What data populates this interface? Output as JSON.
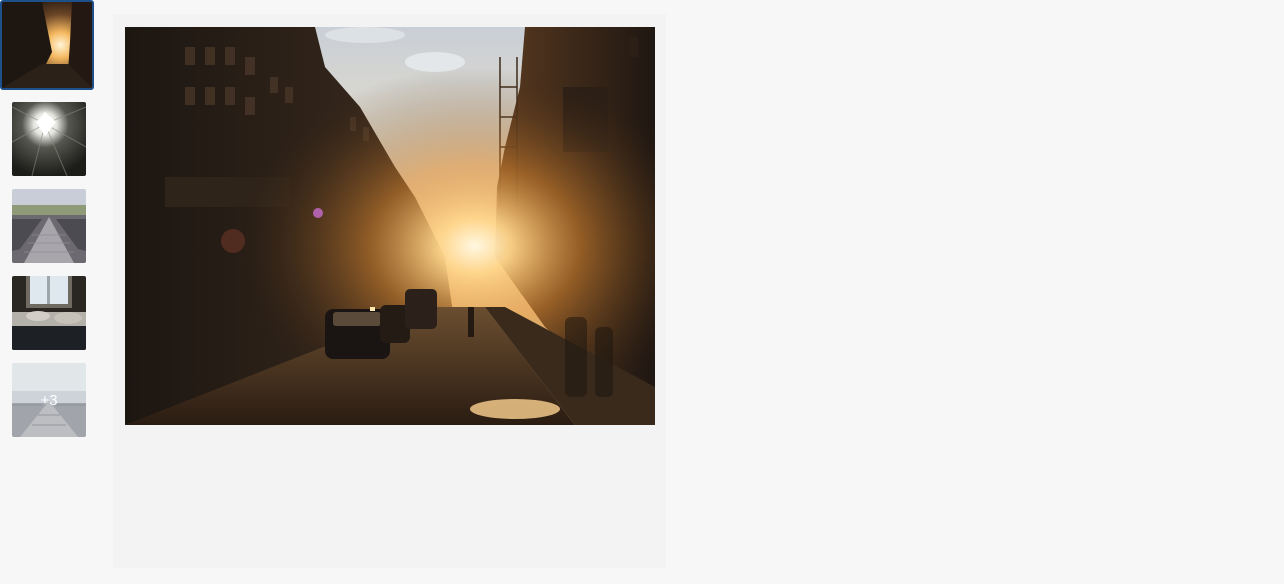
{
  "gallery": {
    "selected_index": 0,
    "thumbnails": [
      {
        "id": "street-sunset",
        "icon": "street-sunset-thumbnail"
      },
      {
        "id": "tunnel-light",
        "icon": "tunnel-light-thumbnail"
      },
      {
        "id": "bridge-walkway",
        "icon": "bridge-walkway-thumbnail"
      },
      {
        "id": "bedroom-window",
        "icon": "bedroom-window-thumbnail"
      },
      {
        "id": "pier",
        "icon": "pier-thumbnail"
      }
    ],
    "more_count_label": "+3"
  },
  "colors": {
    "page_background": "#f7f7f7",
    "viewer_background": "#f3f3f3",
    "selected_border": "#1d4f8a"
  }
}
